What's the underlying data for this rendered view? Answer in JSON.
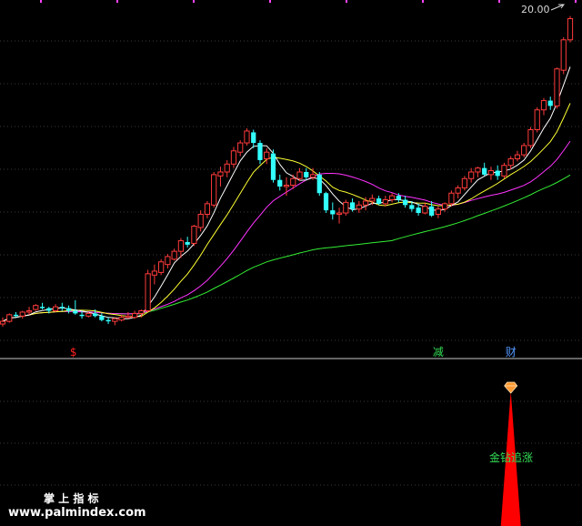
{
  "chart_data": {
    "type": "candlestick",
    "price_panel": {
      "price_label": "20.00",
      "signal_markers": [
        {
          "text": "$",
          "bar": 11,
          "color": "#ff2020"
        },
        {
          "text": "减",
          "bar": 66,
          "color": "#33dd55"
        },
        {
          "text": "财",
          "bar": 77,
          "color": "#5599ff"
        }
      ],
      "candles": [
        [
          7.1,
          7.6,
          6.9,
          7.3
        ],
        [
          7.3,
          7.9,
          7.2,
          7.8
        ],
        [
          7.8,
          8.0,
          7.6,
          7.7
        ],
        [
          7.7,
          8.1,
          7.5,
          8.0
        ],
        [
          8.0,
          8.4,
          7.8,
          8.1
        ],
        [
          8.2,
          8.6,
          8.1,
          8.5
        ],
        [
          8.4,
          8.7,
          8.2,
          8.3
        ],
        [
          8.3,
          8.4,
          7.9,
          8.1
        ],
        [
          8.1,
          8.6,
          8.0,
          8.4
        ],
        [
          8.4,
          8.7,
          8.1,
          8.3
        ],
        [
          8.3,
          8.5,
          7.9,
          8.1
        ],
        [
          8.1,
          8.9,
          7.8,
          7.9
        ],
        [
          7.8,
          8.1,
          7.5,
          7.7
        ],
        [
          7.7,
          8.0,
          7.6,
          7.9
        ],
        [
          7.9,
          8.2,
          7.6,
          7.7
        ],
        [
          7.7,
          7.9,
          7.3,
          7.4
        ],
        [
          7.4,
          7.6,
          7.1,
          7.3
        ],
        [
          7.3,
          7.6,
          7.0,
          7.5
        ],
        [
          7.4,
          7.8,
          7.3,
          7.6
        ],
        [
          7.6,
          8.0,
          7.5,
          7.7
        ],
        [
          7.6,
          8.1,
          7.5,
          7.9
        ],
        [
          7.9,
          8.2,
          7.6,
          8.1
        ],
        [
          8.1,
          11.2,
          8.0,
          10.9
        ],
        [
          10.8,
          11.6,
          10.1,
          11.1
        ],
        [
          11.0,
          12.0,
          10.8,
          11.8
        ],
        [
          11.6,
          12.4,
          11.3,
          12.2
        ],
        [
          12.0,
          12.8,
          11.9,
          12.6
        ],
        [
          12.6,
          13.6,
          12.1,
          13.4
        ],
        [
          13.3,
          13.7,
          12.9,
          13.1
        ],
        [
          13.2,
          14.6,
          13.0,
          14.5
        ],
        [
          14.4,
          15.7,
          14.1,
          15.4
        ],
        [
          15.4,
          16.4,
          15.1,
          16.2
        ],
        [
          16.1,
          18.6,
          15.9,
          18.4
        ],
        [
          18.3,
          19.0,
          17.5,
          18.6
        ],
        [
          18.6,
          19.5,
          18.2,
          19.2
        ],
        [
          19.2,
          20.5,
          18.9,
          20.2
        ],
        [
          20.1,
          21.0,
          19.8,
          20.8
        ],
        [
          20.8,
          21.9,
          20.6,
          21.7
        ],
        [
          21.6,
          21.8,
          20.4,
          20.8
        ],
        [
          20.8,
          21.0,
          19.2,
          19.5
        ],
        [
          19.6,
          20.4,
          19.2,
          20.1
        ],
        [
          20.0,
          20.3,
          17.8,
          18.0
        ],
        [
          18.0,
          18.4,
          17.2,
          17.5
        ],
        [
          17.5,
          18.2,
          16.8,
          17.6
        ],
        [
          17.6,
          18.4,
          17.3,
          18.1
        ],
        [
          18.1,
          18.9,
          17.9,
          18.6
        ],
        [
          18.6,
          18.9,
          18.0,
          18.2
        ],
        [
          18.2,
          18.9,
          18.0,
          18.4
        ],
        [
          18.4,
          18.6,
          16.8,
          17.0
        ],
        [
          17.0,
          17.1,
          15.5,
          15.7
        ],
        [
          15.7,
          16.3,
          15.0,
          15.4
        ],
        [
          15.4,
          15.9,
          14.7,
          15.5
        ],
        [
          15.5,
          16.5,
          15.3,
          16.3
        ],
        [
          16.3,
          16.6,
          15.6,
          15.8
        ],
        [
          15.8,
          16.4,
          15.5,
          16.1
        ],
        [
          16.1,
          16.7,
          15.7,
          16.4
        ],
        [
          16.4,
          16.9,
          16.1,
          16.6
        ],
        [
          16.6,
          16.8,
          16.1,
          16.2
        ],
        [
          16.2,
          16.8,
          16.0,
          16.5
        ],
        [
          16.5,
          17.0,
          16.3,
          16.8
        ],
        [
          16.8,
          17.0,
          16.3,
          16.5
        ],
        [
          16.5,
          16.8,
          15.9,
          16.1
        ],
        [
          16.1,
          16.4,
          15.6,
          15.8
        ],
        [
          15.9,
          16.2,
          15.3,
          15.5
        ],
        [
          15.5,
          16.3,
          15.4,
          16.0
        ],
        [
          16.0,
          16.4,
          15.2,
          15.3
        ],
        [
          15.4,
          16.0,
          15.1,
          15.8
        ],
        [
          15.8,
          16.3,
          15.6,
          16.2
        ],
        [
          16.2,
          17.2,
          16.0,
          17.0
        ],
        [
          17.0,
          17.6,
          16.6,
          17.4
        ],
        [
          17.4,
          18.3,
          17.2,
          18.1
        ],
        [
          18.1,
          18.9,
          17.8,
          18.6
        ],
        [
          18.6,
          19.0,
          18.2,
          18.9
        ],
        [
          18.9,
          19.3,
          18.3,
          18.4
        ],
        [
          18.4,
          19.0,
          18.0,
          18.7
        ],
        [
          18.7,
          19.1,
          18.0,
          18.3
        ],
        [
          18.3,
          19.3,
          18.1,
          19.1
        ],
        [
          19.1,
          19.8,
          18.8,
          19.6
        ],
        [
          19.6,
          20.2,
          19.4,
          19.9
        ],
        [
          19.9,
          20.8,
          19.7,
          20.6
        ],
        [
          20.6,
          22.0,
          20.4,
          21.8
        ],
        [
          21.8,
          23.5,
          21.6,
          23.3
        ],
        [
          23.3,
          24.2,
          22.9,
          24.0
        ],
        [
          24.0,
          24.3,
          23.3,
          23.6
        ],
        [
          23.6,
          26.5,
          23.4,
          26.4
        ],
        [
          26.3,
          28.8,
          26.0,
          28.6
        ],
        [
          28.6,
          30.4,
          28.4,
          30.2
        ]
      ],
      "ma_colors": {
        "ma5": "#ffffff",
        "ma10": "#ffff33",
        "ma20": "#ff33ff",
        "ma60": "#33ee33"
      },
      "ylim": [
        6.0,
        31.2
      ]
    },
    "indicator_panel": {
      "signal_label": "金钻追涨",
      "signal_bar": 77,
      "signal_color": "#ff0000",
      "diamond_color": "#ff9933",
      "label_color": "#33dd55"
    }
  },
  "watermark": {
    "title": "掌 上 指 标",
    "url": "www.palmindex.com"
  }
}
